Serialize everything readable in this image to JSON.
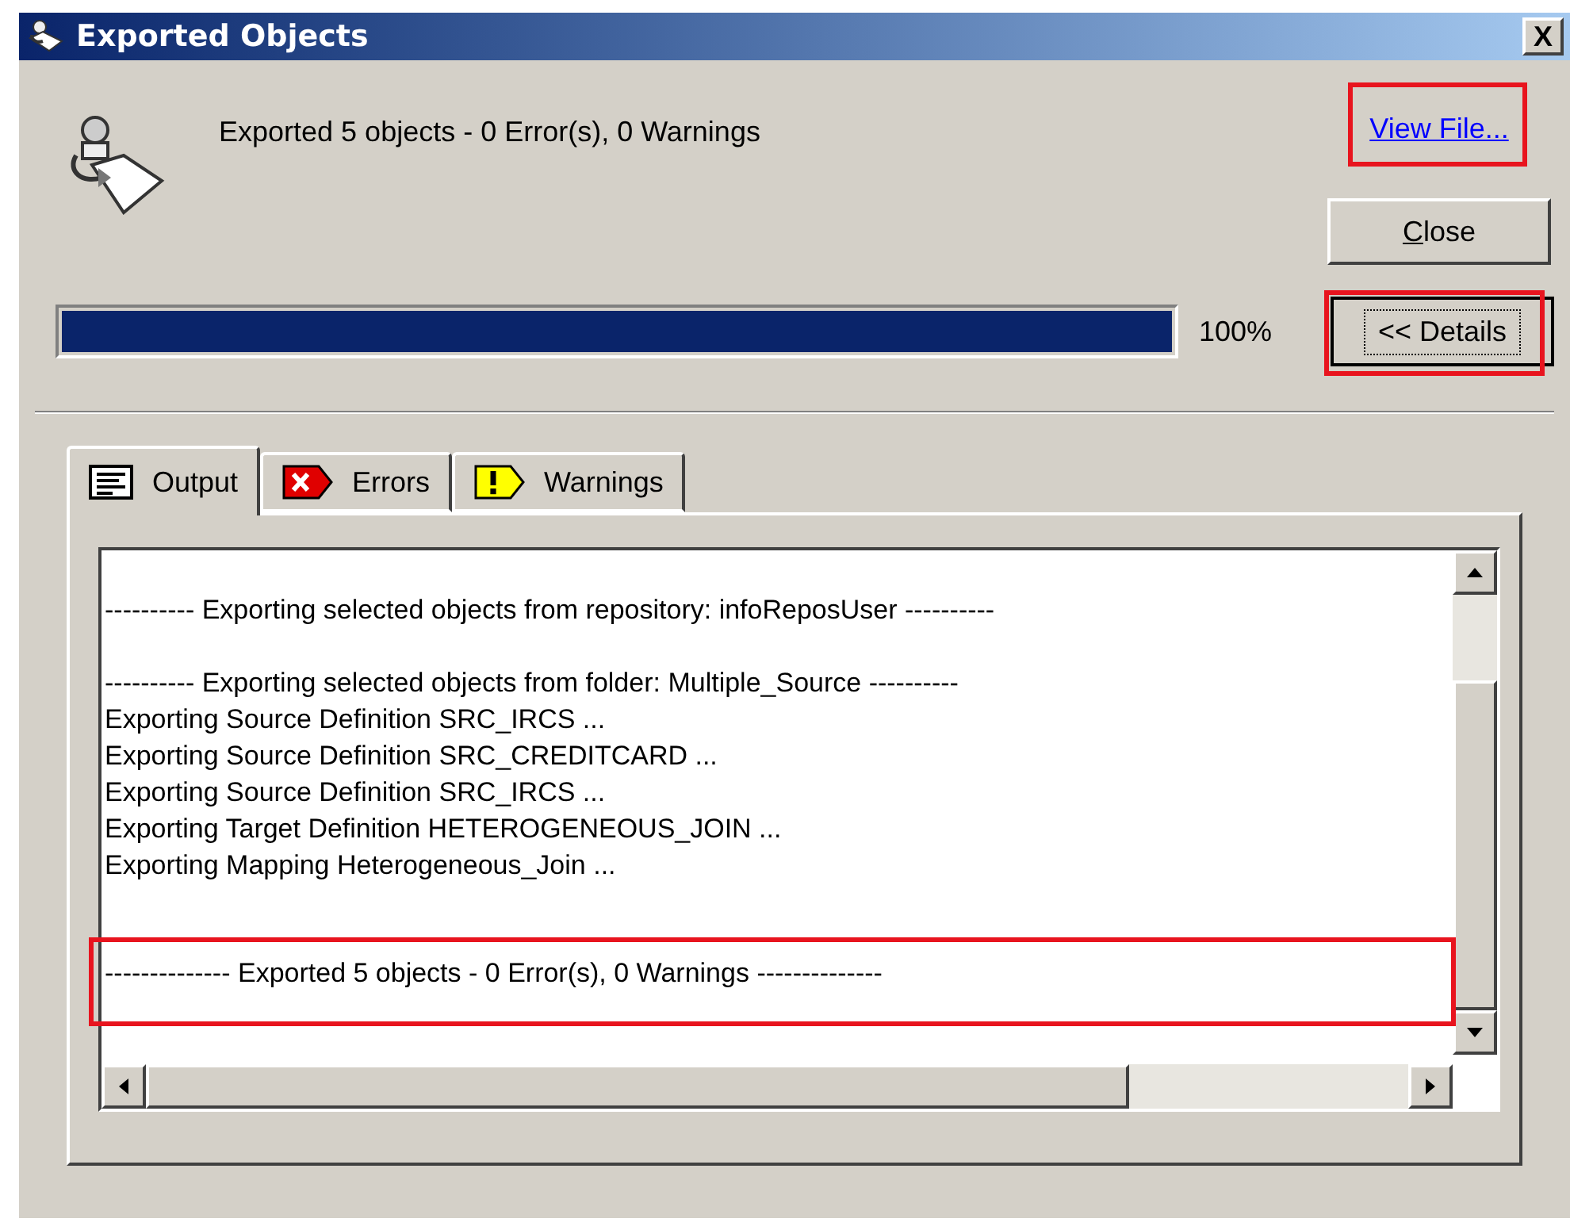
{
  "window": {
    "title": "Exported Objects",
    "close_glyph": "X"
  },
  "summary": "Exported 5 objects - 0 Error(s), 0 Warnings",
  "view_file_link": "View File...",
  "close_button": {
    "label": "Close"
  },
  "progress": {
    "level": 1,
    "reading": "100%"
  },
  "details_button": "<< Details",
  "tabs": [
    {
      "kind": "output",
      "label": "Output",
      "selected": true
    },
    {
      "kind": "errors",
      "label": "Errors",
      "selected": false
    },
    {
      "kind": "warnings",
      "label": "Warnings",
      "selected": false
    }
  ],
  "log_blocks": [
    [
      "---------- Exporting selected objects from repository: infoReposUser ----------"
    ],
    [
      "---------- Exporting selected objects from folder: Multiple_Source ----------",
      "Exporting Source Definition SRC_IRCS ...",
      "Exporting Source Definition SRC_CREDITCARD ...",
      "Exporting Source Definition SRC_IRCS ...",
      "Exporting Target Definition HETEROGENEOUS_JOIN ...",
      "Exporting Mapping Heterogeneous_Join ..."
    ],
    [
      "-------------- Exported 5 objects - 0 Error(s), 0 Warnings --------------"
    ]
  ]
}
